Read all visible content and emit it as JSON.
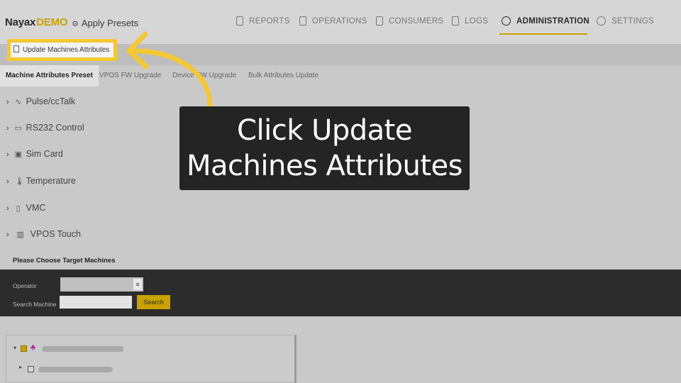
{
  "header": {
    "brand": "Nayax",
    "brand_suffix": "DEMO",
    "page_title": "Apply Presets",
    "nav": [
      {
        "label": "REPORTS",
        "icon": "document-icon"
      },
      {
        "label": "OPERATIONS",
        "icon": "phone-icon"
      },
      {
        "label": "CONSUMERS",
        "icon": "id-card-icon"
      },
      {
        "label": "LOGS",
        "icon": "clipboard-icon"
      },
      {
        "label": "ADMINISTRATION",
        "icon": "gauge-icon",
        "active": true
      },
      {
        "label": "SETTINGS",
        "icon": "gear-icon"
      }
    ]
  },
  "toolbar": {
    "update_label": "Update Machines Attributes"
  },
  "tabs": [
    {
      "label": "Machine Attributes Preset",
      "active": true
    },
    {
      "label": "VPOS FW Upgrade"
    },
    {
      "label": "Device FW Upgrade"
    },
    {
      "label": "Bulk Attributes Update"
    }
  ],
  "tree": [
    {
      "label": "Pulse/ccTalk",
      "icon": "pulse-icon"
    },
    {
      "label": "RS232 Control",
      "icon": "connector-icon"
    },
    {
      "label": "Sim Card",
      "icon": "sim-card-icon"
    },
    {
      "label": "Temperature",
      "icon": "thermometer-icon"
    },
    {
      "label": "VMC",
      "icon": "vmc-icon"
    },
    {
      "label": "VPOS Touch",
      "icon": "vpos-device-icon"
    }
  ],
  "target": {
    "heading": "Please Choose Target Machines",
    "operator_label": "Operator",
    "search_label": "Search Machine",
    "search_placeholder": "",
    "search_button": "Search"
  },
  "callout": {
    "line1": "Click Update",
    "line2": "Machines Attributes"
  },
  "colors": {
    "accent": "#f4c832",
    "brand_yellow": "#c8a200",
    "callout_bg": "#242424"
  }
}
